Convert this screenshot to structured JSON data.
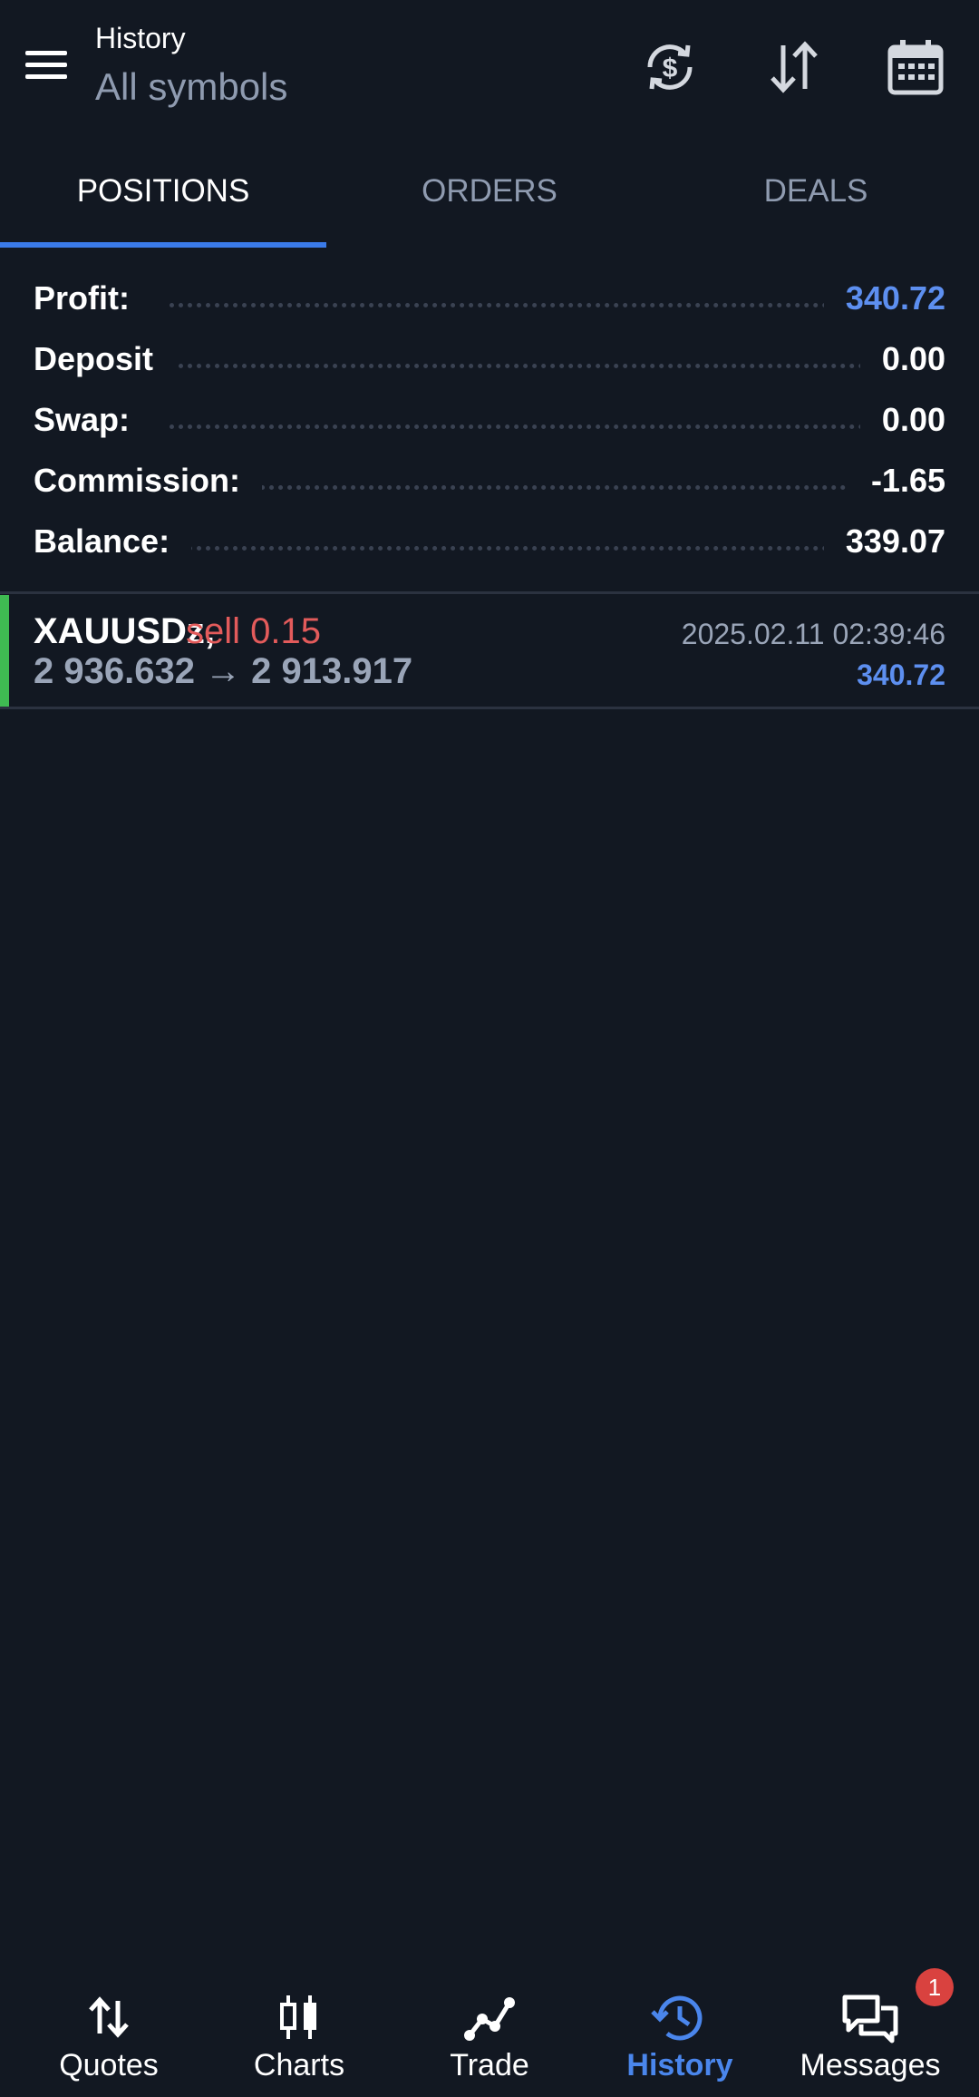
{
  "header": {
    "title": "History",
    "subtitle": "All symbols",
    "icons": [
      "currency-refresh-icon",
      "sort-arrows-icon",
      "calendar-icon"
    ]
  },
  "tabs": [
    {
      "label": "POSITIONS",
      "active": true
    },
    {
      "label": "ORDERS",
      "active": false
    },
    {
      "label": "DEALS",
      "active": false
    }
  ],
  "summary": {
    "profit": {
      "label": "Profit:",
      "value": "340.72"
    },
    "deposit": {
      "label": "Deposit",
      "value": "0.00"
    },
    "swap": {
      "label": "Swap:",
      "value": "0.00"
    },
    "commission": {
      "label": "Commission:",
      "value": "-1.65"
    },
    "balance": {
      "label": "Balance:",
      "value": "339.07"
    }
  },
  "positions": [
    {
      "symbol": "XAUUSDz,",
      "side": "sell 0.15",
      "prices": "2 936.632 → 2 913.917",
      "time": "2025.02.11 02:39:46",
      "profit": "340.72"
    }
  ],
  "bottom_nav": [
    {
      "label": "Quotes",
      "icon": "quotes-arrows-icon"
    },
    {
      "label": "Charts",
      "icon": "candlestick-icon"
    },
    {
      "label": "Trade",
      "icon": "trade-line-icon"
    },
    {
      "label": "History",
      "icon": "history-clock-icon",
      "active": true
    },
    {
      "label": "Messages",
      "icon": "chat-bubbles-icon",
      "badge": "1"
    }
  ],
  "colors": {
    "background": "#121822",
    "accent": "#3b7be9",
    "profit_blue": "#5d8ff0",
    "sell_red": "#e35b5b",
    "buy_bar_green": "#3fbb52",
    "badge_red": "#d9423f"
  }
}
